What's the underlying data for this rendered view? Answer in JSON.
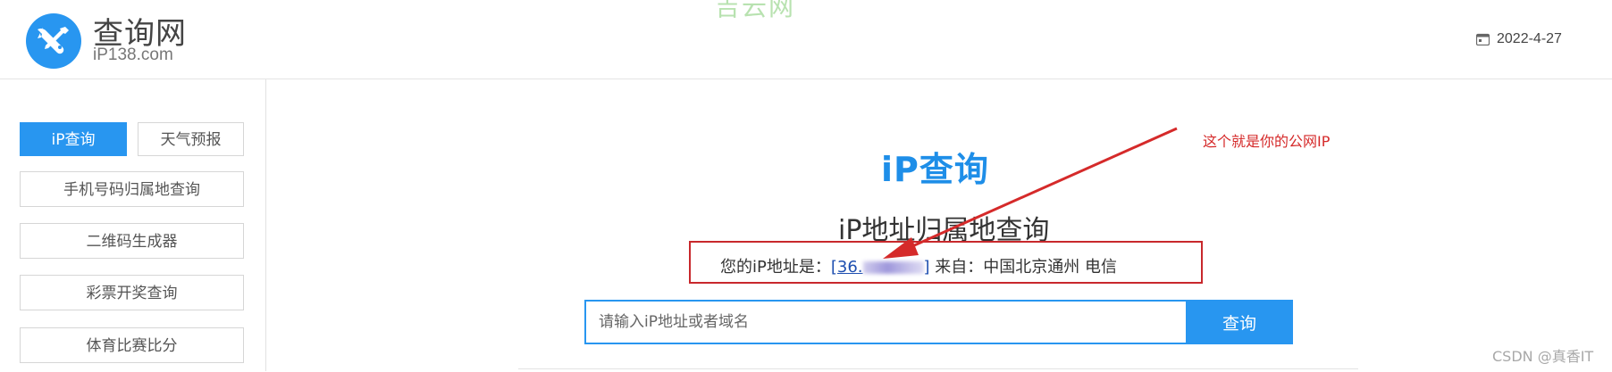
{
  "header": {
    "logo_icon": "wrench-screwdriver-icon",
    "site_name": "查询网",
    "site_domain": "iP138.com",
    "watermark": "吉云网",
    "date_icon": "calendar-icon",
    "date": "2022-4-27"
  },
  "sidebar": {
    "items": [
      {
        "label": "iP查询",
        "active": true
      },
      {
        "label": "天气预报",
        "active": false
      },
      {
        "label": "手机号码归属地查询",
        "active": false
      },
      {
        "label": "二维码生成器",
        "active": false
      },
      {
        "label": "彩票开奖查询",
        "active": false
      },
      {
        "label": "体育比赛比分",
        "active": false
      }
    ]
  },
  "main": {
    "title": "iP查询",
    "subtitle": "iP地址归属地查询",
    "ip_line": {
      "prefix": "您的iP地址是：",
      "ip_visible": "[36.",
      "ip_suffix": "]",
      "from_label": " 来自：中国北京通州 电信"
    },
    "annotation": "这个就是你的公网IP",
    "search": {
      "placeholder": "请输入iP地址或者域名",
      "value": "",
      "button_label": "查询"
    }
  },
  "colors": {
    "accent": "#2896f0",
    "annotation_red": "#d52a2a"
  },
  "footer": {
    "credit": "CSDN @真香IT"
  }
}
